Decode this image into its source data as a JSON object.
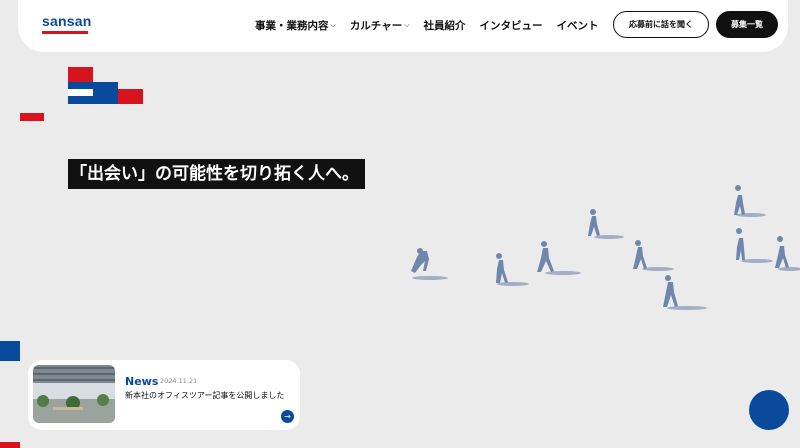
{
  "brand": {
    "logo_text": "sansan"
  },
  "nav": {
    "items": [
      {
        "label": "事業・業務内容",
        "has_dropdown": true
      },
      {
        "label": "カルチャー",
        "has_dropdown": true
      },
      {
        "label": "社員紹介",
        "has_dropdown": false
      },
      {
        "label": "インタビュー",
        "has_dropdown": false
      },
      {
        "label": "イベント",
        "has_dropdown": false
      }
    ],
    "chevron": "⌵"
  },
  "buttons": {
    "consult": "応募前に話を聞く",
    "jobs": "募集一覧"
  },
  "hero": {
    "headline": "「出会い」の可能性を切り拓く人へ。"
  },
  "news": {
    "title": "News",
    "date": "2024.11.21",
    "body": "新本社のオフィスツアー記事を公開しました",
    "arrow": "→"
  },
  "colors": {
    "brand_blue": "#0a4a9c",
    "brand_red": "#d7141e",
    "background": "#ebebeb"
  },
  "icons": {
    "news_arrow": "arrow-right-icon",
    "scroll": "circle-button"
  }
}
